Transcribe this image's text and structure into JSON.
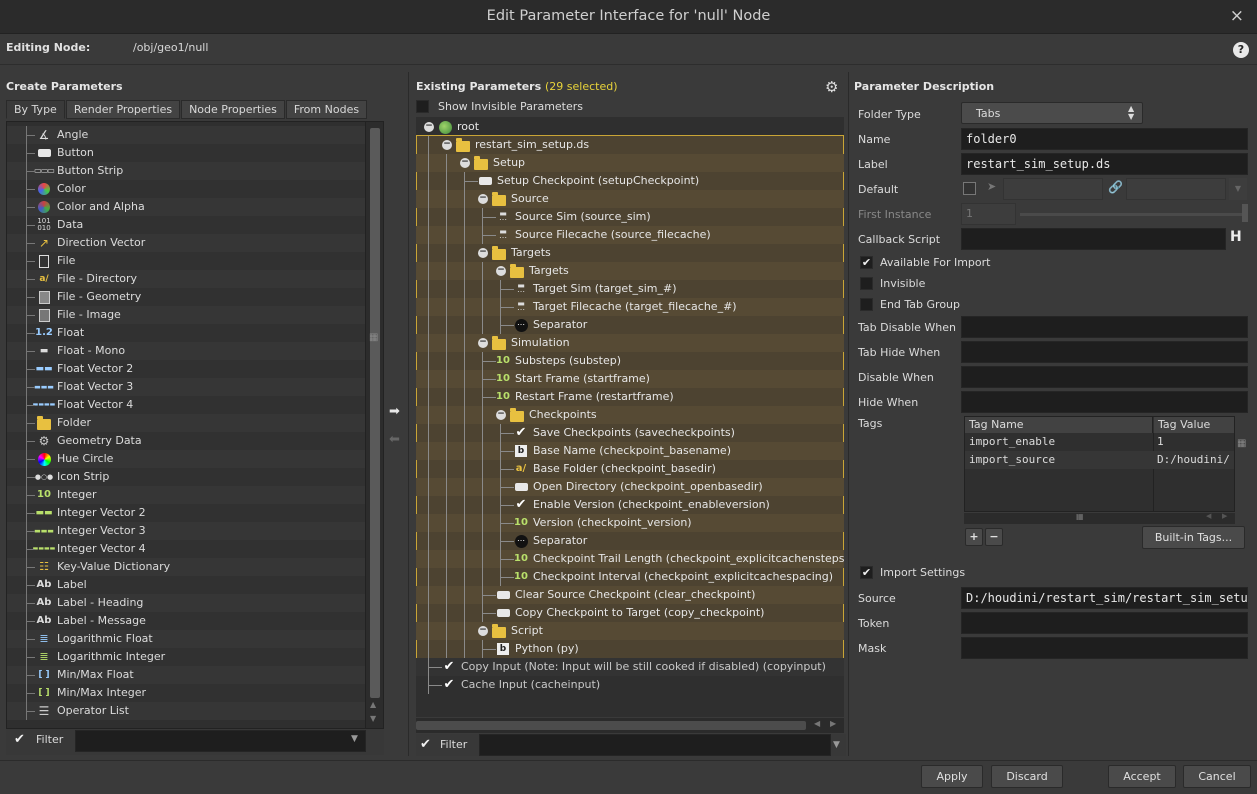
{
  "window": {
    "title": "Edit Parameter Interface for 'null' Node",
    "close_glyph": "×"
  },
  "editing": {
    "label": "Editing Node:",
    "value": "/obj/geo1/null",
    "help_glyph": "?"
  },
  "create": {
    "title": "Create Parameters",
    "tabs": [
      "By Type",
      "Render Properties",
      "Node Properties",
      "From Nodes"
    ],
    "items": [
      {
        "label": "Angle",
        "icon": "angle-icon"
      },
      {
        "label": "Button",
        "icon": "button-icon"
      },
      {
        "label": "Button Strip",
        "icon": "button-strip-icon"
      },
      {
        "label": "Color",
        "icon": "color-icon"
      },
      {
        "label": "Color and Alpha",
        "icon": "color-alpha-icon"
      },
      {
        "label": "Data",
        "icon": "data-icon"
      },
      {
        "label": "Direction Vector",
        "icon": "direction-vector-icon"
      },
      {
        "label": "File",
        "icon": "file-icon"
      },
      {
        "label": "File - Directory",
        "icon": "file-directory-icon"
      },
      {
        "label": "File - Geometry",
        "icon": "file-geometry-icon"
      },
      {
        "label": "File - Image",
        "icon": "file-image-icon"
      },
      {
        "label": "Float",
        "icon": "float-icon"
      },
      {
        "label": "Float - Mono",
        "icon": "float-mono-icon"
      },
      {
        "label": "Float Vector 2",
        "icon": "float-vector2-icon"
      },
      {
        "label": "Float Vector 3",
        "icon": "float-vector3-icon"
      },
      {
        "label": "Float Vector 4",
        "icon": "float-vector4-icon"
      },
      {
        "label": "Folder",
        "icon": "folder-icon"
      },
      {
        "label": "Geometry Data",
        "icon": "geometry-data-icon"
      },
      {
        "label": "Hue Circle",
        "icon": "hue-circle-icon"
      },
      {
        "label": "Icon Strip",
        "icon": "icon-strip-icon"
      },
      {
        "label": "Integer",
        "icon": "integer-icon"
      },
      {
        "label": "Integer Vector 2",
        "icon": "integer-vector2-icon"
      },
      {
        "label": "Integer Vector 3",
        "icon": "integer-vector3-icon"
      },
      {
        "label": "Integer Vector 4",
        "icon": "integer-vector4-icon"
      },
      {
        "label": "Key-Value Dictionary",
        "icon": "key-value-icon"
      },
      {
        "label": "Label",
        "icon": "label-icon"
      },
      {
        "label": "Label - Heading",
        "icon": "label-heading-icon"
      },
      {
        "label": "Label - Message",
        "icon": "label-message-icon"
      },
      {
        "label": "Logarithmic Float",
        "icon": "log-float-icon"
      },
      {
        "label": "Logarithmic Integer",
        "icon": "log-integer-icon"
      },
      {
        "label": "Min/Max Float",
        "icon": "minmax-float-icon"
      },
      {
        "label": "Min/Max Integer",
        "icon": "minmax-integer-icon"
      },
      {
        "label": "Operator List",
        "icon": "operator-list-icon"
      }
    ],
    "filter_label": "Filter"
  },
  "existing": {
    "title": "Existing Parameters",
    "selected": "(29 selected)",
    "show_invisible": "Show Invisible Parameters",
    "filter_label": "Filter",
    "tree": [
      {
        "label": "root",
        "depth": 0,
        "kind": "root",
        "exp": true
      },
      {
        "label": "restart_sim_setup.ds",
        "depth": 1,
        "kind": "folder",
        "exp": true
      },
      {
        "label": "Setup",
        "depth": 2,
        "kind": "folder",
        "exp": true
      },
      {
        "label": "Setup Checkpoint (setupCheckpoint)",
        "depth": 3,
        "kind": "button"
      },
      {
        "label": "Source",
        "depth": 3,
        "kind": "folder",
        "exp": true
      },
      {
        "label": "Source Sim (source_sim)",
        "depth": 4,
        "kind": "op"
      },
      {
        "label": "Source Filecache (source_filecache)",
        "depth": 4,
        "kind": "op"
      },
      {
        "label": "Targets",
        "depth": 3,
        "kind": "folder",
        "exp": true
      },
      {
        "label": "Targets",
        "depth": 4,
        "kind": "folder",
        "exp": true
      },
      {
        "label": "Target Sim (target_sim_#)",
        "depth": 5,
        "kind": "op"
      },
      {
        "label": "Target Filecache (target_filecache_#)",
        "depth": 5,
        "kind": "op"
      },
      {
        "label": "Separator",
        "depth": 5,
        "kind": "sep"
      },
      {
        "label": "Simulation",
        "depth": 3,
        "kind": "folder",
        "exp": true
      },
      {
        "label": "Substeps (substep)",
        "depth": 4,
        "kind": "int"
      },
      {
        "label": "Start Frame (startframe)",
        "depth": 4,
        "kind": "int"
      },
      {
        "label": "Restart Frame (restartframe)",
        "depth": 4,
        "kind": "int"
      },
      {
        "label": "Checkpoints",
        "depth": 4,
        "kind": "folder",
        "exp": true
      },
      {
        "label": "Save Checkpoints (savecheckpoints)",
        "depth": 5,
        "kind": "toggle"
      },
      {
        "label": "Base Name (checkpoint_basename)",
        "depth": 5,
        "kind": "string"
      },
      {
        "label": "Base Folder (checkpoint_basedir)",
        "depth": 5,
        "kind": "dir"
      },
      {
        "label": "Open Directory (checkpoint_openbasedir)",
        "depth": 5,
        "kind": "button"
      },
      {
        "label": "Enable Version (checkpoint_enableversion)",
        "depth": 5,
        "kind": "toggle"
      },
      {
        "label": "Version (checkpoint_version)",
        "depth": 5,
        "kind": "int"
      },
      {
        "label": "Separator",
        "depth": 5,
        "kind": "sep"
      },
      {
        "label": "Checkpoint Trail Length (checkpoint_explicitcachensteps)",
        "depth": 5,
        "kind": "int"
      },
      {
        "label": "Checkpoint Interval (checkpoint_explicitcachespacing)",
        "depth": 5,
        "kind": "int"
      },
      {
        "label": "Clear Source Checkpoint (clear_checkpoint)",
        "depth": 4,
        "kind": "button"
      },
      {
        "label": "Copy Checkpoint to Target (copy_checkpoint)",
        "depth": 4,
        "kind": "button"
      },
      {
        "label": "Script",
        "depth": 3,
        "kind": "folder",
        "exp": true
      },
      {
        "label": "Python (py)",
        "depth": 4,
        "kind": "string"
      },
      {
        "label": "Copy Input (Note: Input will be still cooked if disabled) (copyinput)",
        "depth": 1,
        "kind": "toggle",
        "unselected": true
      },
      {
        "label": "Cache Input (cacheinput)",
        "depth": 1,
        "kind": "toggle",
        "unselected": true
      }
    ]
  },
  "desc": {
    "title": "Parameter Description",
    "folder_type_label": "Folder Type",
    "folder_type_value": "Tabs",
    "name_label": "Name",
    "name_value": "folder0",
    "label_label": "Label",
    "label_value": "restart_sim_setup.ds",
    "default_label": "Default",
    "first_instance_label": "First Instance",
    "first_instance_value": "1",
    "callback_label": "Callback Script",
    "available_import": "Available For Import",
    "invisible": "Invisible",
    "end_tab_group": "End Tab Group",
    "tab_disable_when": "Tab Disable When",
    "tab_hide_when": "Tab Hide When",
    "disable_when": "Disable When",
    "hide_when": "Hide When",
    "tags_label": "Tags",
    "tags_header": [
      "Tag Name",
      "Tag Value"
    ],
    "tags_rows": [
      [
        "import_enable",
        "1"
      ],
      [
        "import_source",
        "D:/houdini/"
      ]
    ],
    "builtin_tags": "Built-in Tags...",
    "import_settings": "Import Settings",
    "source_label": "Source",
    "source_value": "D:/houdini/restart_sim/restart_sim_setup",
    "token_label": "Token",
    "mask_label": "Mask",
    "plus": "+",
    "minus": "−"
  },
  "footer": {
    "apply": "Apply",
    "discard": "Discard",
    "accept": "Accept",
    "cancel": "Cancel"
  },
  "colors": {
    "selection_fill": "#4d4331",
    "selection_border": "#c9a536",
    "accent_yellow": "#e8d33a"
  }
}
